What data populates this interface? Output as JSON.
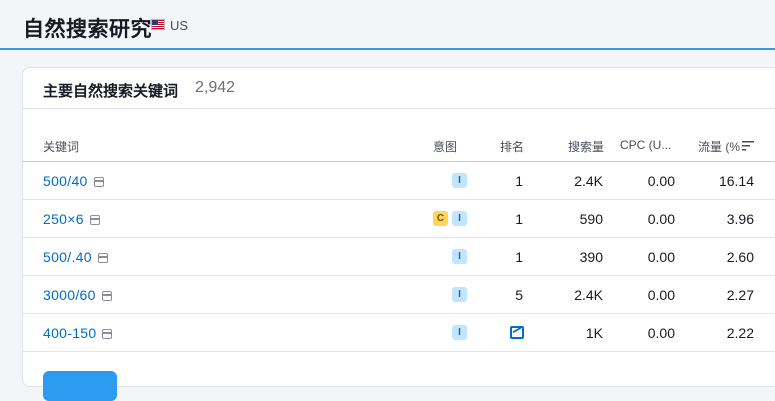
{
  "header": {
    "title": "自然搜索研究",
    "region": "US"
  },
  "card": {
    "title": "主要自然搜索关键词",
    "count": "2,942",
    "columns": {
      "keyword": "关键词",
      "intent": "意图",
      "rank": "排名",
      "volume": "搜索量",
      "cpc": "CPC (U...",
      "traffic": "流量 (%"
    },
    "rows": [
      {
        "keyword": "500/40",
        "intents": [
          "I"
        ],
        "rank": "1",
        "volume": "2.4K",
        "cpc": "0.00",
        "traffic": "16.14"
      },
      {
        "keyword": "250×6",
        "intents": [
          "C",
          "I"
        ],
        "rank": "1",
        "volume": "590",
        "cpc": "0.00",
        "traffic": "3.96"
      },
      {
        "keyword": "500/.40",
        "intents": [
          "I"
        ],
        "rank": "1",
        "volume": "390",
        "cpc": "0.00",
        "traffic": "2.60"
      },
      {
        "keyword": "3000/60",
        "intents": [
          "I"
        ],
        "rank": "5",
        "volume": "2.4K",
        "cpc": "0.00",
        "traffic": "2.27"
      },
      {
        "keyword": "400-150",
        "intents": [
          "I"
        ],
        "rank_icon": "image-serp-icon",
        "volume": "1K",
        "cpc": "0.00",
        "traffic": "2.22"
      }
    ]
  },
  "colors": {
    "accent": "#2d9bf0",
    "link": "#006dca",
    "intent_informational": "#c2e5ff",
    "intent_commercial": "#ffd55c"
  }
}
